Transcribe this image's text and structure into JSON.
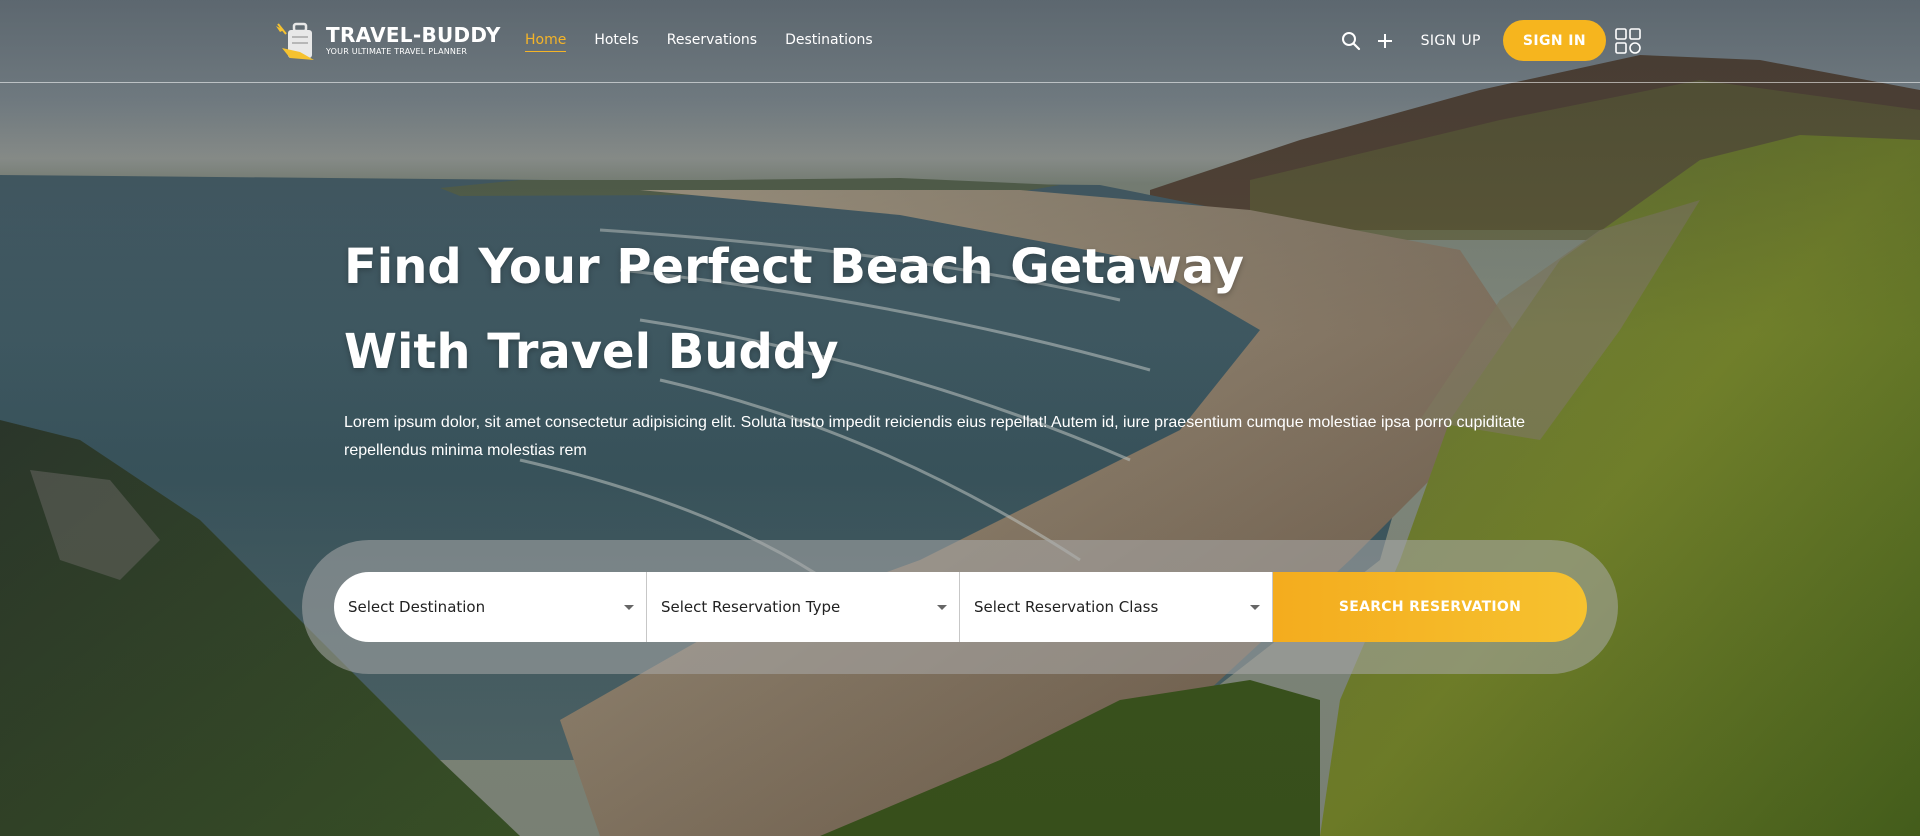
{
  "brand": {
    "name": "TRAVEL-BUDDY",
    "tagline": "YOUR ULTIMATE TRAVEL PLANNER",
    "accent_color": "#f6b51e"
  },
  "nav": {
    "items": [
      {
        "label": "Home",
        "active": true
      },
      {
        "label": "Hotels",
        "active": false
      },
      {
        "label": "Reservations",
        "active": false
      },
      {
        "label": "Destinations",
        "active": false
      }
    ]
  },
  "header_actions": {
    "search_icon": "search-icon",
    "add_icon": "plus-icon",
    "signup_label": "SIGN UP",
    "signin_label": "SIGN IN",
    "menu_icon": "grid-menu-icon"
  },
  "hero": {
    "title_line1": "Find Your Perfect Beach Getaway",
    "title_line2": "With Travel Buddy",
    "description": "Lorem ipsum dolor, sit amet consectetur adipisicing elit. Soluta iusto impedit reiciendis eius repellat! Autem id, iure praesentium cumque molestiae ipsa porro cupiditate repellendus minima molestias rem"
  },
  "search": {
    "destination_label": "Select Destination",
    "type_label": "Select Reservation Type",
    "class_label": "Select Reservation Class",
    "button_label": "SEARCH RESERVATION"
  }
}
